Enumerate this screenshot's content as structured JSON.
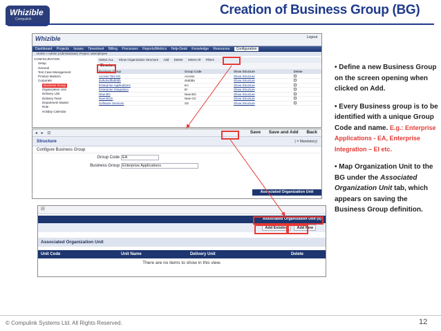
{
  "header": {
    "title": "Creation of Business Group (BG)",
    "logo_text": "Whizible",
    "logo_sub": "Compulink",
    "logo_tagline": "ENTERPRISE PROJECT MANAGEMENT"
  },
  "screen1": {
    "logo": "Whizible",
    "logout": "Logout",
    "nav": [
      "Dashboard",
      "Projects",
      "Issues",
      "Timesheet",
      "Billing",
      "Processes",
      "Reports/Metrics",
      "Help-Desk",
      "Knowledge",
      "Resources",
      "Configuration"
    ],
    "nav_active": "Configuration",
    "breadcrumb": "Home > Admin (Administrator) Project: wtemployee",
    "tree": [
      "CONFIGURATION",
      "Setup",
      "General",
      "Test Case Management",
      "Product Masters",
      "Corporate",
      "Business Group",
      "Organization Unit",
      "Delivery Unit",
      "Delivery Team",
      "Department Master",
      "Role",
      "Holiday Calendar"
    ],
    "tree_selected": "Business Group",
    "toolbar": {
      "select": "Select ALL",
      "show_structure": "Show Organization Structure",
      "add": "Add",
      "delete": "Delete",
      "select_all": "Select All",
      "filters": "Filters"
    },
    "structure_label": "Structure",
    "columns": [
      "Business Group",
      "Group Code",
      "Show Structure",
      "Delete"
    ],
    "rows": [
      {
        "name": "Access Tam bG",
        "code": "Access",
        "link": "Show Structure"
      },
      {
        "name": "dvdvdvdfbdbfdb",
        "code": "dvddda",
        "link": "Show Structure"
      },
      {
        "name": "Enterprise Applications",
        "code": "EA",
        "link": "Show Structure"
      },
      {
        "name": "Enterprise Integration",
        "code": "EI",
        "link": "Show Structure"
      },
      {
        "name": "New BG",
        "code": "New BG",
        "link": "Show Structure"
      },
      {
        "name": "New BGG",
        "code": "New GC",
        "link": "Show Structure"
      },
      {
        "name": "Software Services",
        "code": "SS",
        "link": "Show Structure"
      }
    ]
  },
  "screen2": {
    "save": "Save",
    "save_and_add": "Save and Add",
    "back": "Back",
    "mandatory": "( = Mandatory)",
    "structure": "Structure",
    "configure": "Configure Business Group",
    "group_code_label": "Group Code",
    "group_code_value": "EA",
    "business_group_label": "Business Group",
    "business_group_value": "Enterprise Applications",
    "tab": "Associated Organization Unit"
  },
  "screen3": {
    "tab_header": "Associated Organization Unit (0)",
    "add_existing": "Add Existing",
    "add_new": "Add New",
    "section": "Associated Organization Unit",
    "columns": [
      "Unit Code",
      "Unit Name",
      "Delivery Unit",
      "Delete"
    ],
    "empty_message": "There are no items to show in this view."
  },
  "bullets": {
    "b1": "• Define a new Business Group on the screen opening when clicked on Add.",
    "b2_main": "• Every Business group is to be identified with a unique Group Code and name.",
    "b2_example": "E.g.: Enterprise Applications - EA, Enterprise Integration – EI etc.",
    "b3_pre": "• Map Organization Unit to the BG under the ",
    "b3_em": "Associated Organization Unit",
    "b3_post": " tab, which appears on saving the Business Group definition."
  },
  "footer": {
    "copyright": "© Compulink Systems Ltd. All Rights Reserved.",
    "page": "12"
  },
  "colors": {
    "title": "#1f3a8a",
    "highlight": "#e53935",
    "nav": "#1d3670"
  }
}
